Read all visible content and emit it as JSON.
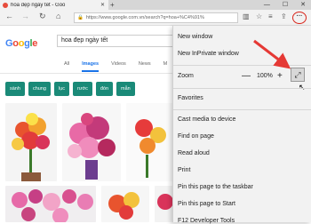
{
  "browser": {
    "tab_title": "hoa đẹp ngày tết - Goo",
    "tab_close": "✕",
    "new_tab": "+",
    "window_controls": [
      "—",
      "☐",
      "✕"
    ],
    "address": "https://www.google.com.vn/search?q=hoa+%C4%91%",
    "more_button": "···"
  },
  "google": {
    "logo_letters": [
      "G",
      "o",
      "o",
      "g",
      "l",
      "e"
    ],
    "search_query": "hoa đẹp ngày tết",
    "tabs": [
      "All",
      "Images",
      "Videos",
      "News",
      "M"
    ],
    "active_tab": "Images",
    "chips": [
      "sành",
      "chung",
      "lục",
      "rước",
      "đón",
      "mẫn"
    ]
  },
  "menu": {
    "new_window": "New window",
    "new_inprivate": "New InPrivate window",
    "zoom_label": "Zoom",
    "zoom_minus": "—",
    "zoom_value": "100%",
    "zoom_plus": "+",
    "fullscreen_icon": "⤢",
    "favorites": "Favorites",
    "cast": "Cast media to device",
    "find": "Find on page",
    "read_aloud": "Read aloud",
    "print": "Print",
    "pin_taskbar": "Pin this page to the taskbar",
    "pin_start": "Pin this page to Start",
    "dev_tools": "F12 Developer Tools"
  },
  "colors": {
    "arrow": "#e53935",
    "chip": "#1a8a78",
    "highlight": "#d9261c"
  }
}
